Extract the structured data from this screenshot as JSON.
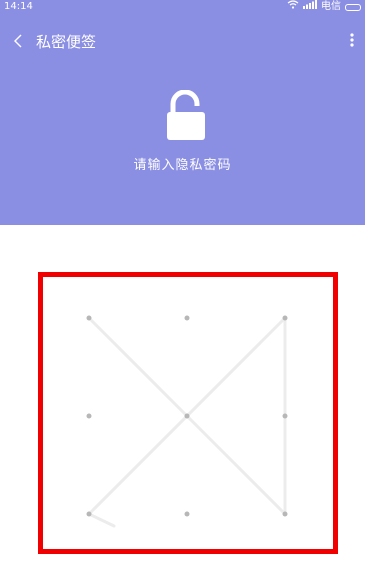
{
  "status_bar": {
    "time": "14:14",
    "carrier": "电信",
    "wifi_icon": "wifi-icon",
    "signal_icon": "signal-icon",
    "battery_icon": "battery-icon"
  },
  "toolbar": {
    "back_icon": "chevron-left-icon",
    "title": "私密便签",
    "menu_icon": "more-vertical-icon"
  },
  "lock": {
    "icon": "lock-icon",
    "prompt": "请输入隐私密码"
  },
  "pattern": {
    "grid": "3x3",
    "highlight_color": "#f00000",
    "header_color": "#8b8fe3",
    "path_nodes": [
      1,
      5,
      9,
      3,
      7
    ]
  }
}
